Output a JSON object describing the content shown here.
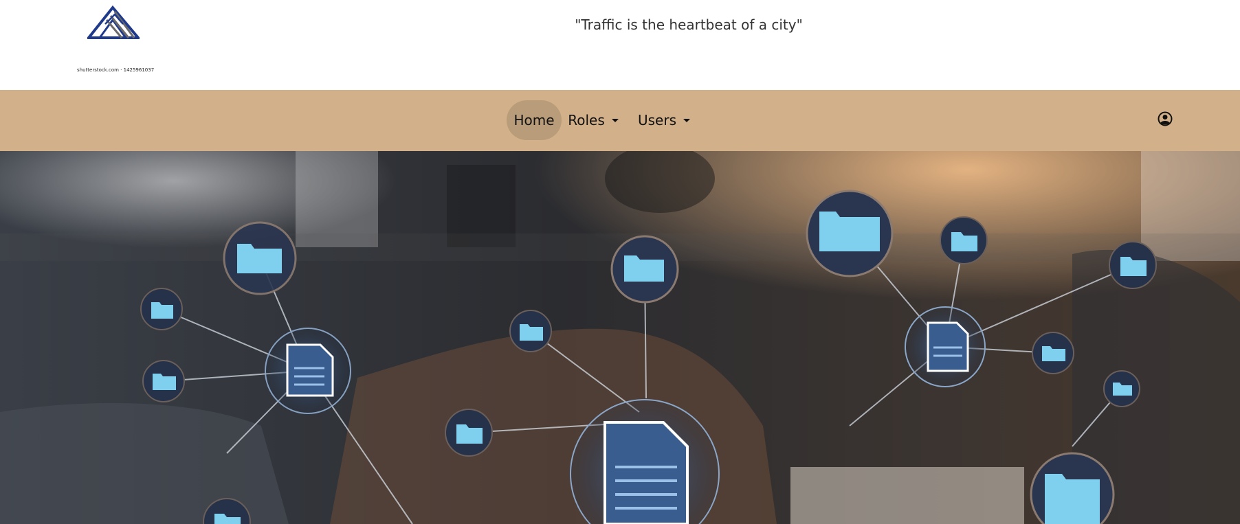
{
  "header": {
    "tagline": "\"Traffic is the heartbeat of a city\"",
    "logo_caption": "shutterstock.com · 1425961037",
    "logo_icon": "mountain-stripes-logo",
    "logo_color": "#1f3a8a"
  },
  "nav": {
    "background": "#d2b08a",
    "active_background": "#b99c7a",
    "items": [
      {
        "label": "Home",
        "active": true
      },
      {
        "label": "Roles",
        "dropdown": true
      },
      {
        "label": "Users",
        "dropdown": true
      }
    ],
    "user_icon": "user-circle-icon"
  },
  "hero": {
    "description_icon": "network-document-folders-image"
  }
}
